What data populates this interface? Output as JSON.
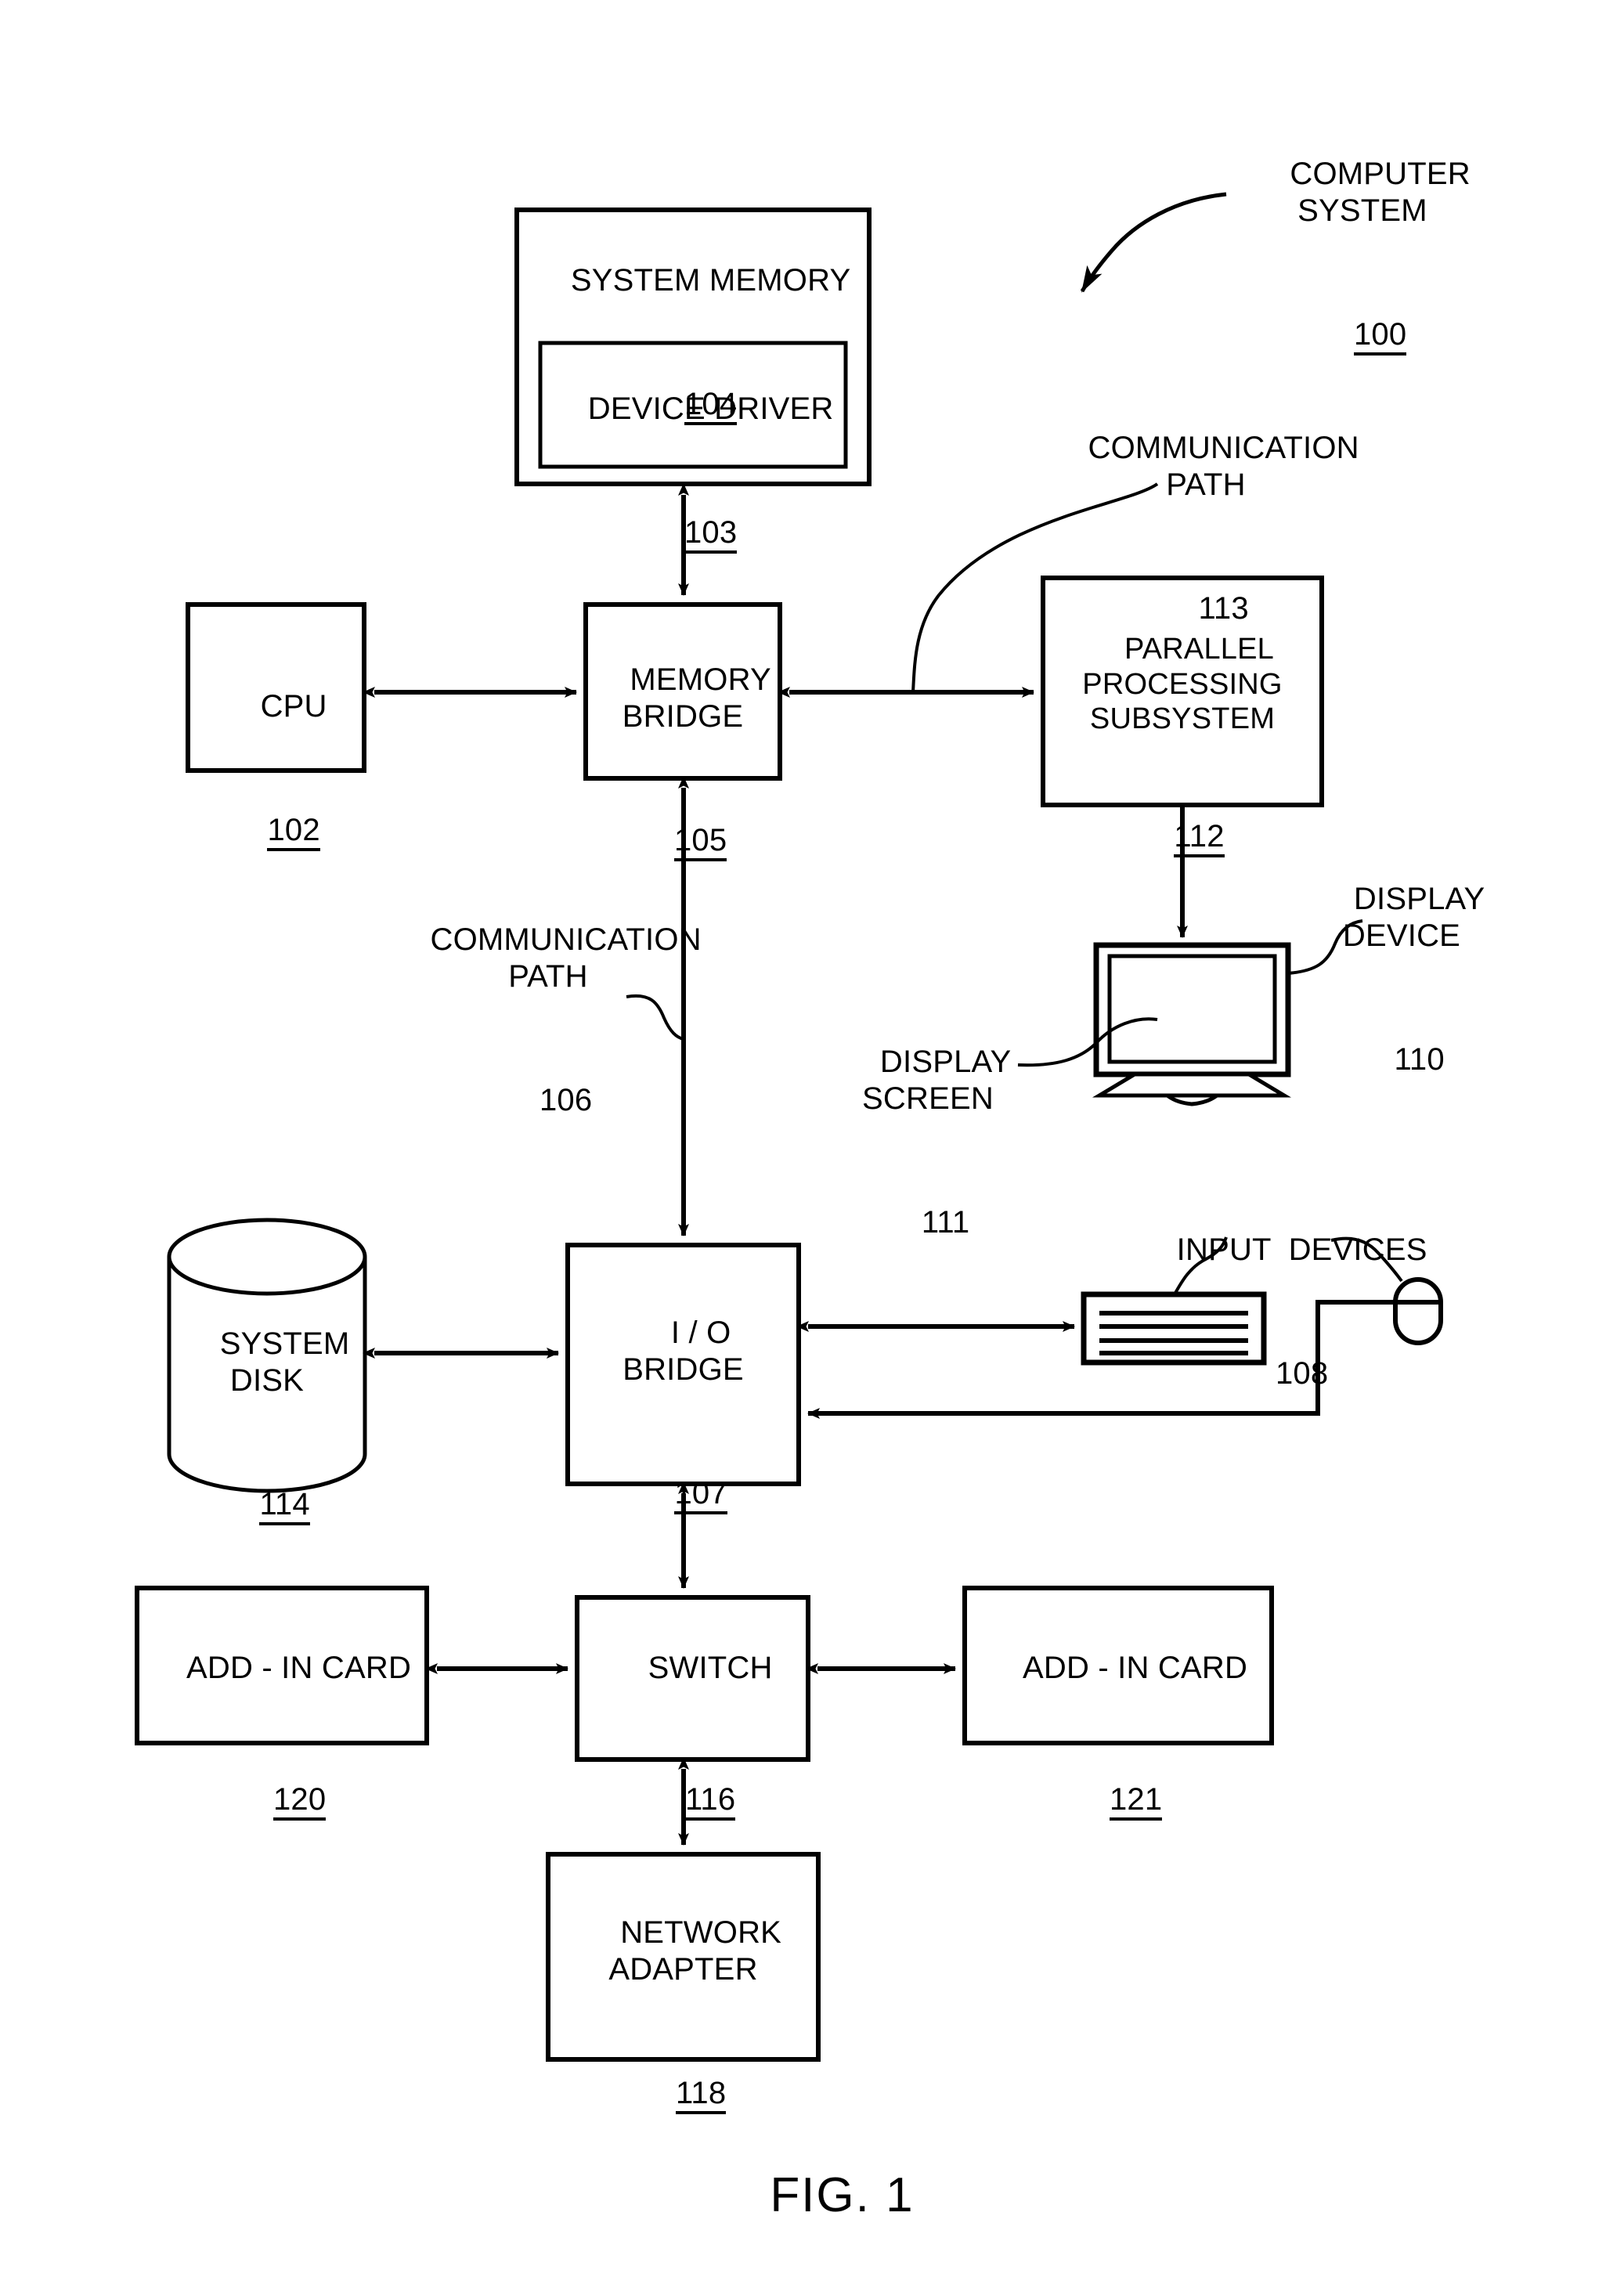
{
  "figure": {
    "caption": "FIG. 1",
    "title_callout": "COMPUTER\nSYSTEM",
    "title_ref": "100"
  },
  "blocks": [
    {
      "id": "system-memory",
      "title": "SYSTEM MEMORY",
      "ref": "104"
    },
    {
      "id": "device-driver",
      "title": "DEVICE DRIVER",
      "ref": "103"
    },
    {
      "id": "cpu",
      "title": "CPU",
      "ref": "102"
    },
    {
      "id": "memory-bridge",
      "title": "MEMORY\nBRIDGE",
      "ref": "105"
    },
    {
      "id": "parallel-processing-subsystem",
      "title": "PARALLEL\nPROCESSING\nSUBSYSTEM",
      "ref": "112"
    },
    {
      "id": "system-disk",
      "title": "SYSTEM\nDISK",
      "ref": "114"
    },
    {
      "id": "io-bridge",
      "title": "I / O\nBRIDGE",
      "ref": "107"
    },
    {
      "id": "add-in-card-left",
      "title": "ADD - IN CARD",
      "ref": "120"
    },
    {
      "id": "switch",
      "title": "SWITCH",
      "ref": "116"
    },
    {
      "id": "add-in-card-right",
      "title": "ADD - IN CARD",
      "ref": "121"
    },
    {
      "id": "network-adapter",
      "title": "NETWORK\nADAPTER",
      "ref": "118"
    }
  ],
  "callouts": [
    {
      "id": "communication-path-113",
      "text": "COMMUNICATION\nPATH",
      "ref": "113"
    },
    {
      "id": "communication-path-106",
      "text": "COMMUNICATION\nPATH",
      "ref": "106"
    },
    {
      "id": "display-device-110",
      "text": "DISPLAY\nDEVICE",
      "ref": "110"
    },
    {
      "id": "display-screen-111",
      "text": "DISPLAY\nSCREEN",
      "ref": "111"
    },
    {
      "id": "input-devices-108",
      "text": "INPUT  DEVICES",
      "ref": "108"
    }
  ],
  "colors": {
    "stroke": "#000000",
    "fill": "#ffffff",
    "background": "#ffffff"
  }
}
